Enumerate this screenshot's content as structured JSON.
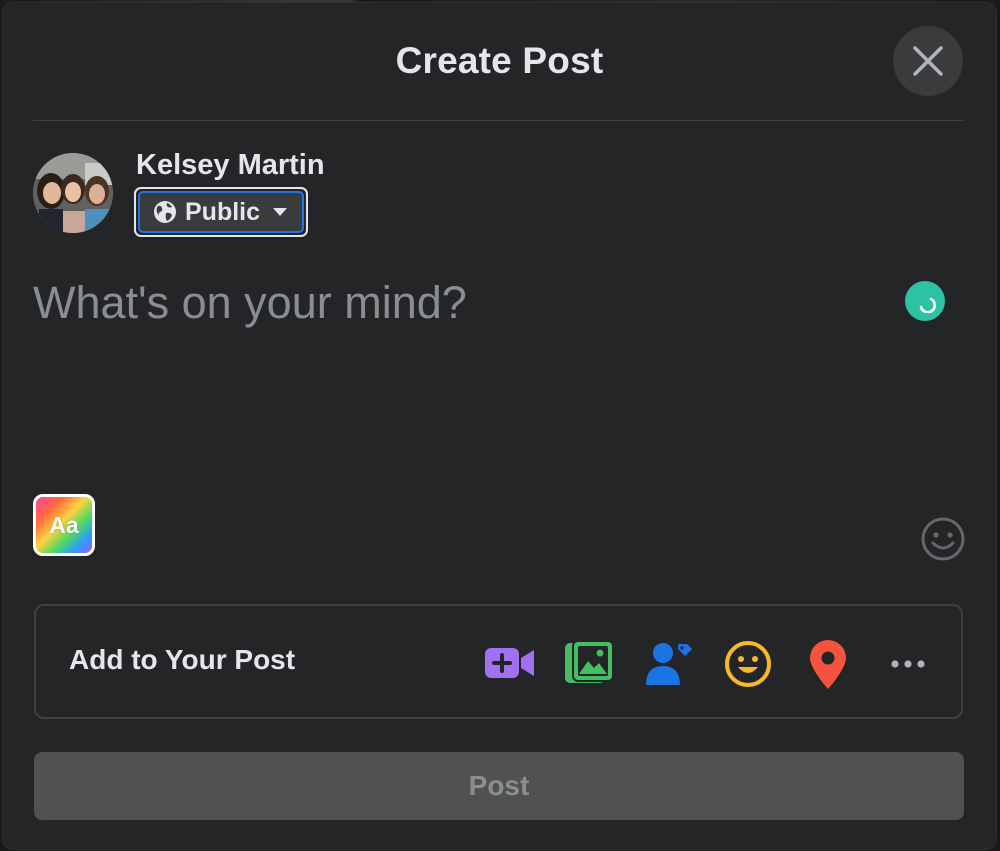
{
  "dialog": {
    "title": "Create Post",
    "close_icon": "close-icon"
  },
  "user": {
    "name": "Kelsey Martin",
    "privacy_label": "Public",
    "privacy_icon": "globe-icon"
  },
  "composer": {
    "placeholder": "What's on your mind?"
  },
  "background_picker": {
    "label": "Aa"
  },
  "add_to_post": {
    "label": "Add to Your Post",
    "items": [
      {
        "name": "live-video",
        "icon": "video-plus-icon",
        "color": "#a270f2"
      },
      {
        "name": "photo-video",
        "icon": "photo-icon",
        "color": "#45bd62"
      },
      {
        "name": "tag-people",
        "icon": "tag-people-icon",
        "color": "#1b74e4"
      },
      {
        "name": "feeling-activity",
        "icon": "smiley-icon",
        "color": "#f7b928"
      },
      {
        "name": "check-in",
        "icon": "location-pin-icon",
        "color": "#f5533d"
      },
      {
        "name": "more",
        "icon": "more-icon",
        "color": "#b0b3b8"
      }
    ]
  },
  "post_button": {
    "label": "Post"
  },
  "colors": {
    "dialog_bg": "#242526",
    "text_primary": "#e4e6eb",
    "text_secondary": "#8a8d91",
    "focus_ring": "#2374e1",
    "grammar_green": "#2ec2a5",
    "post_disabled_bg": "#505151"
  }
}
